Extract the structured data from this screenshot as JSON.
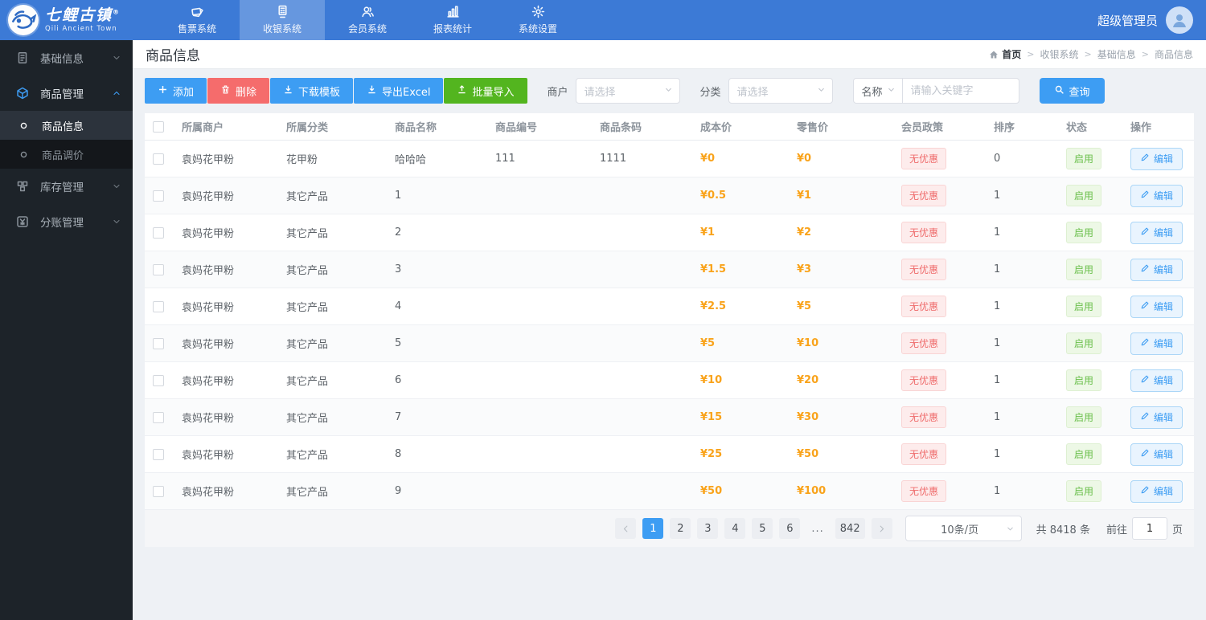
{
  "brand": {
    "title": "七鲤古镇",
    "registered": "®",
    "subtitle": "Qili Ancient Town"
  },
  "topnav": {
    "items": [
      {
        "label": "售票系统",
        "icon": "tickets",
        "active": false
      },
      {
        "label": "收银系统",
        "icon": "pos",
        "active": true
      },
      {
        "label": "会员系统",
        "icon": "members",
        "active": false
      },
      {
        "label": "报表统计",
        "icon": "chart",
        "active": false
      },
      {
        "label": "系统设置",
        "icon": "gear",
        "active": false
      }
    ],
    "user": "超级管理员"
  },
  "sidebar": {
    "items": [
      {
        "label": "基础信息",
        "icon": "doc",
        "state": "collapsed"
      },
      {
        "label": "商品管理",
        "icon": "cube",
        "state": "expanded",
        "children": [
          {
            "label": "商品信息",
            "active": true
          },
          {
            "label": "商品调价",
            "active": false
          }
        ]
      },
      {
        "label": "库存管理",
        "icon": "boxes",
        "state": "collapsed"
      },
      {
        "label": "分账管理",
        "icon": "yen",
        "state": "collapsed"
      }
    ]
  },
  "page": {
    "title": "商品信息"
  },
  "breadcrumb": [
    "首页",
    "收银系统",
    "基础信息",
    "商品信息"
  ],
  "toolbar": {
    "add": "添加",
    "delete": "删除",
    "download_template": "下载模板",
    "export_excel": "导出Excel",
    "batch_import": "批量导入"
  },
  "filters": {
    "merchant_label": "商户",
    "merchant_placeholder": "请选择",
    "category_label": "分类",
    "category_placeholder": "请选择",
    "name_field_label": "名称",
    "keyword_placeholder": "请输入关键字",
    "search_label": "查询"
  },
  "table": {
    "columns": [
      "所属商户",
      "所属分类",
      "商品名称",
      "商品编号",
      "商品条码",
      "成本价",
      "零售价",
      "会员政策",
      "排序",
      "状态",
      "操作"
    ],
    "edit_label": "编辑",
    "rows": [
      {
        "merchant": "袁妈花甲粉",
        "category": "花甲粉",
        "name": "哈哈哈",
        "number": "111",
        "barcode": "1111",
        "cost": "¥0",
        "price": "¥0",
        "policy": "无优惠",
        "sort": "0",
        "status": "启用"
      },
      {
        "merchant": "袁妈花甲粉",
        "category": "其它产品",
        "name": "1",
        "number": "",
        "barcode": "",
        "cost": "¥0.5",
        "price": "¥1",
        "policy": "无优惠",
        "sort": "1",
        "status": "启用"
      },
      {
        "merchant": "袁妈花甲粉",
        "category": "其它产品",
        "name": "2",
        "number": "",
        "barcode": "",
        "cost": "¥1",
        "price": "¥2",
        "policy": "无优惠",
        "sort": "1",
        "status": "启用"
      },
      {
        "merchant": "袁妈花甲粉",
        "category": "其它产品",
        "name": "3",
        "number": "",
        "barcode": "",
        "cost": "¥1.5",
        "price": "¥3",
        "policy": "无优惠",
        "sort": "1",
        "status": "启用"
      },
      {
        "merchant": "袁妈花甲粉",
        "category": "其它产品",
        "name": "4",
        "number": "",
        "barcode": "",
        "cost": "¥2.5",
        "price": "¥5",
        "policy": "无优惠",
        "sort": "1",
        "status": "启用"
      },
      {
        "merchant": "袁妈花甲粉",
        "category": "其它产品",
        "name": "5",
        "number": "",
        "barcode": "",
        "cost": "¥5",
        "price": "¥10",
        "policy": "无优惠",
        "sort": "1",
        "status": "启用"
      },
      {
        "merchant": "袁妈花甲粉",
        "category": "其它产品",
        "name": "6",
        "number": "",
        "barcode": "",
        "cost": "¥10",
        "price": "¥20",
        "policy": "无优惠",
        "sort": "1",
        "status": "启用"
      },
      {
        "merchant": "袁妈花甲粉",
        "category": "其它产品",
        "name": "7",
        "number": "",
        "barcode": "",
        "cost": "¥15",
        "price": "¥30",
        "policy": "无优惠",
        "sort": "1",
        "status": "启用"
      },
      {
        "merchant": "袁妈花甲粉",
        "category": "其它产品",
        "name": "8",
        "number": "",
        "barcode": "",
        "cost": "¥25",
        "price": "¥50",
        "policy": "无优惠",
        "sort": "1",
        "status": "启用"
      },
      {
        "merchant": "袁妈花甲粉",
        "category": "其它产品",
        "name": "9",
        "number": "",
        "barcode": "",
        "cost": "¥50",
        "price": "¥100",
        "policy": "无优惠",
        "sort": "1",
        "status": "启用"
      }
    ]
  },
  "pagination": {
    "pages": [
      "1",
      "2",
      "3",
      "4",
      "5",
      "6",
      "...",
      "842"
    ],
    "active_page": "1",
    "page_size": "10条/页",
    "total": "共 8418 条",
    "goto_prefix": "前往",
    "goto_value": "1",
    "goto_suffix": "页"
  },
  "colors": {
    "topbar": "#3c7ad6",
    "accent_blue": "#3d9df3",
    "danger_red": "#f56c6c",
    "success_green": "#53b51f",
    "price_orange": "#f9a31b"
  }
}
